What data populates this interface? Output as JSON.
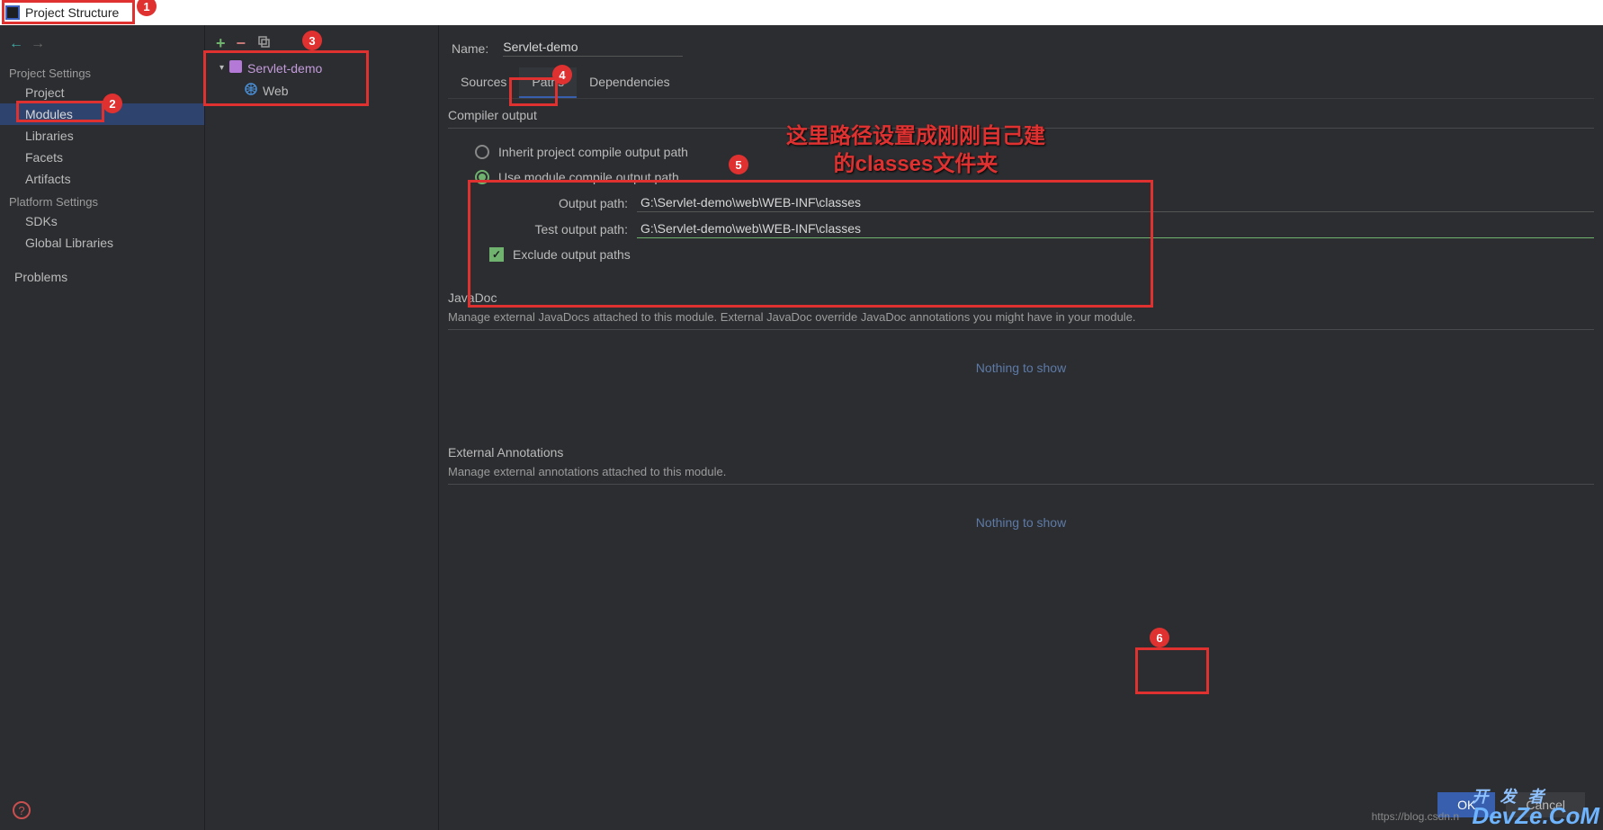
{
  "titlebar": {
    "title": "Project Structure"
  },
  "nav": {
    "project_settings_heading": "Project Settings",
    "project": "Project",
    "modules": "Modules",
    "libraries": "Libraries",
    "facets": "Facets",
    "artifacts": "Artifacts",
    "platform_settings_heading": "Platform Settings",
    "sdks": "SDKs",
    "global_libraries": "Global Libraries",
    "problems": "Problems"
  },
  "tree": {
    "module_name": "Servlet-demo",
    "web": "Web"
  },
  "content": {
    "name_label": "Name:",
    "name_value": "Servlet-demo",
    "tabs": {
      "sources": "Sources",
      "paths": "Paths",
      "dependencies": "Dependencies"
    },
    "compiler": {
      "title": "Compiler output",
      "inherit_label": "Inherit project compile output path",
      "use_module_label": "Use module compile output path",
      "output_path_label": "Output path:",
      "output_path_value": "G:\\Servlet-demo\\web\\WEB-INF\\classes",
      "test_output_path_label": "Test output path:",
      "test_output_path_value": "G:\\Servlet-demo\\web\\WEB-INF\\classes",
      "exclude_label": "Exclude output paths"
    },
    "javadoc": {
      "title": "JavaDoc",
      "desc": "Manage external JavaDocs attached to this module. External JavaDoc override JavaDoc annotations you might have in your module.",
      "nothing": "Nothing to show"
    },
    "external": {
      "title": "External Annotations",
      "desc": "Manage external annotations attached to this module.",
      "nothing": "Nothing to show"
    }
  },
  "buttons": {
    "ok": "OK",
    "cancel": "Cancel"
  },
  "annotations": {
    "b1": "1",
    "b2": "2",
    "b3": "3",
    "b4": "4",
    "b5": "5",
    "b6": "6",
    "text_line1": "这里路径设置成刚刚自己建",
    "text_line2": "的classes文件夹"
  },
  "watermark": {
    "url": "https://blog.csdn.n",
    "logo_cn": "开 发 者",
    "logo_en": "DevZe.CoM"
  }
}
